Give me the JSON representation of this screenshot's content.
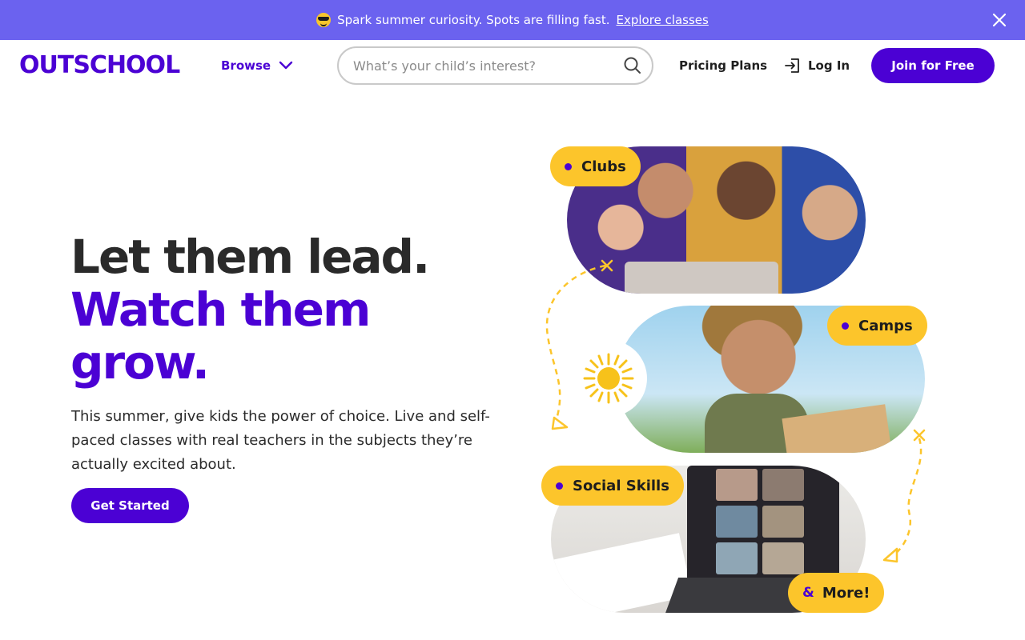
{
  "banner": {
    "emoji_icon": "sunglasses-emoji-icon",
    "text": "Spark summer curiosity. Spots are filling fast.",
    "link_label": "Explore classes",
    "background": "#6b62ef"
  },
  "header": {
    "logo_text": "OUTSCHOOL",
    "browse_label": "Browse",
    "search_placeholder": "What’s your child’s interest?",
    "pricing_label": "Pricing Plans",
    "login_label": "Log In",
    "join_label": "Join for Free",
    "brand_color": "#4b01d4"
  },
  "hero": {
    "headline_line1": "Let them lead.",
    "headline_line2": "Watch them",
    "headline_line3": "grow.",
    "subtitle": "This summer, give kids the power of choice. Live and self-paced classes with real teachers in the subjects they’re actually excited about.",
    "cta_label": "Get Started",
    "tags": {
      "clubs": "Clubs",
      "camps": "Camps",
      "social": "Social Skills",
      "more_amp": "&",
      "more": "More!"
    },
    "accent_yellow": "#fcc52b"
  }
}
